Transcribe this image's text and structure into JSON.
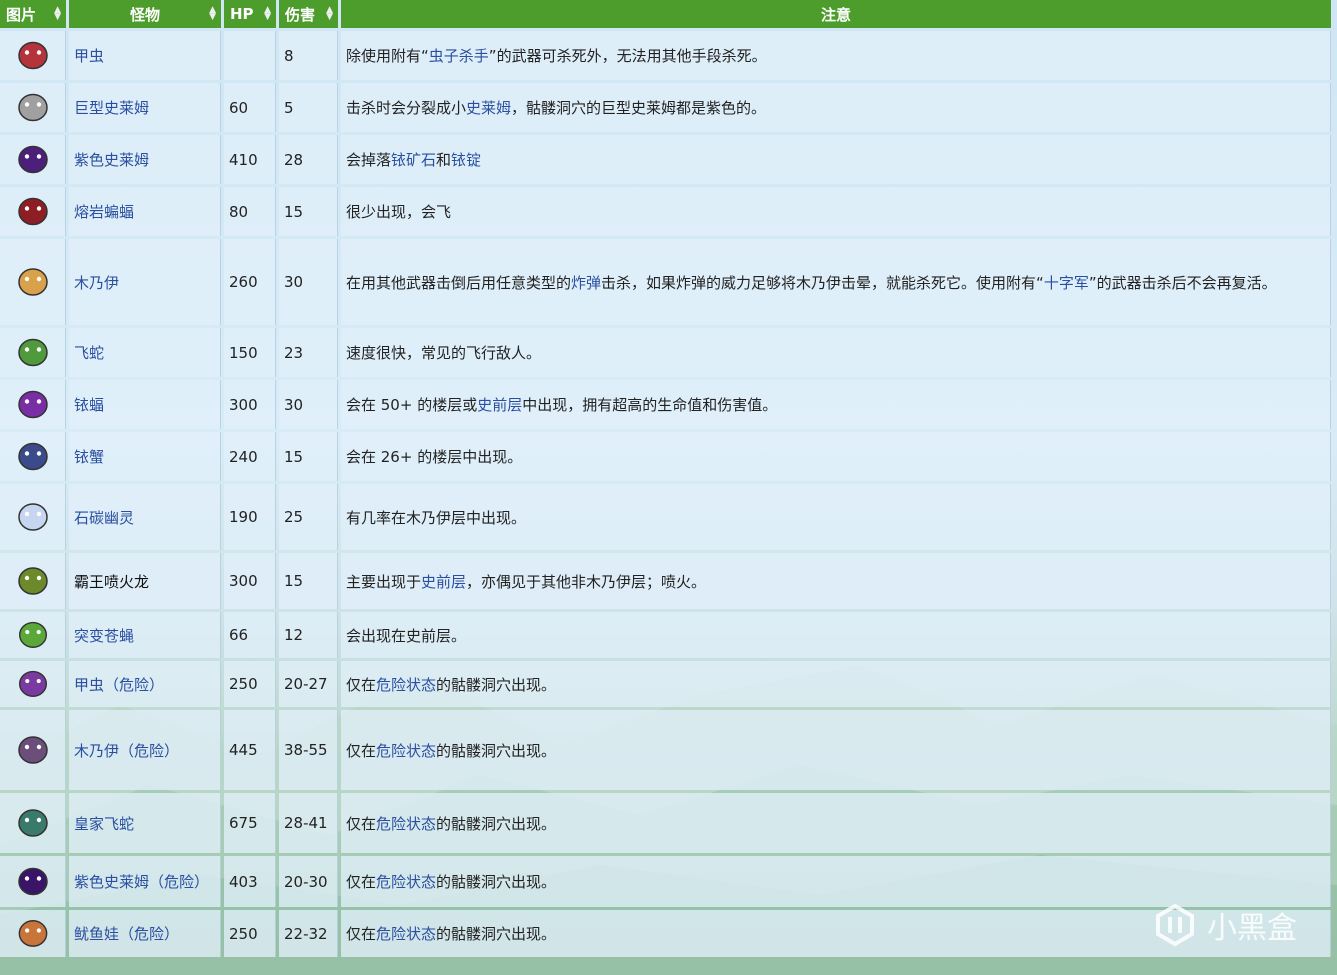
{
  "columns": [
    "图片",
    "怪物",
    "HP",
    "伤害",
    "注意"
  ],
  "rows": [
    {
      "name": "甲虫",
      "name_style": "lnk",
      "hp": "",
      "dmg": "8",
      "note": [
        {
          "t": "除使用附有“"
        },
        {
          "t": "虫子杀手",
          "l": true
        },
        {
          "t": "”的武器可杀死外，无法用其他手段杀死。"
        }
      ],
      "icon": "red-bug-icon",
      "color": "#b5333a"
    },
    {
      "name": "巨型史莱姆",
      "name_style": "lnk",
      "hp": "60",
      "dmg": "5",
      "note": [
        {
          "t": "击杀时会分裂成小"
        },
        {
          "t": "史莱姆",
          "l": true
        },
        {
          "t": "，骷髅洞穴的巨型史莱姆都是紫色的。"
        }
      ],
      "icon": "gray-slime-icon",
      "color": "#a0a0a0"
    },
    {
      "name": "紫色史莱姆",
      "name_style": "lnk",
      "hp": "410",
      "dmg": "28",
      "note": [
        {
          "t": "会掉落"
        },
        {
          "t": "铱矿石",
          "l": true
        },
        {
          "t": "和"
        },
        {
          "t": "铱锭",
          "l": true
        }
      ],
      "icon": "purple-slime-icon",
      "color": "#4b1f7a"
    },
    {
      "name": "熔岩蝙蝠",
      "name_style": "lnk",
      "hp": "80",
      "dmg": "15",
      "note": [
        {
          "t": "很少出现，会飞"
        }
      ],
      "icon": "lava-bat-icon",
      "color": "#8e1d24"
    },
    {
      "name": "木乃伊",
      "name_style": "lnk",
      "hp": "260",
      "dmg": "30",
      "note": [
        {
          "t": "在用其他武器击倒后用任意类型的"
        },
        {
          "t": "炸弹",
          "l": true
        },
        {
          "t": "击杀，如果炸弹的威力足够将木乃伊击晕，就能杀死它。使用附有“"
        },
        {
          "t": "十字军",
          "l": true
        },
        {
          "t": "”的武器击杀后不会再复活。"
        }
      ],
      "icon": "mummy-icon",
      "color": "#d9a24a"
    },
    {
      "name": "飞蛇",
      "name_style": "lnk",
      "hp": "150",
      "dmg": "23",
      "note": [
        {
          "t": "速度很快，常见的飞行敌人。"
        }
      ],
      "icon": "serpent-icon",
      "color": "#4f9a3c"
    },
    {
      "name": "铱蝠",
      "name_style": "lnk",
      "hp": "300",
      "dmg": "30",
      "note": [
        {
          "t": "会在 50+ 的楼层或"
        },
        {
          "t": "史前层",
          "l": true
        },
        {
          "t": "中出现，拥有超高的生命值和伤害值。"
        }
      ],
      "icon": "iridium-bat-icon",
      "color": "#7a2ea6"
    },
    {
      "name": "铱蟹",
      "name_style": "lnk",
      "hp": "240",
      "dmg": "15",
      "note": [
        {
          "t": "会在 26+ 的楼层中出现。"
        }
      ],
      "icon": "iridium-crab-icon",
      "color": "#3b4a8a"
    },
    {
      "name": "石碳幽灵",
      "name_style": "lnk",
      "hp": "190",
      "dmg": "25",
      "note": [
        {
          "t": "有几率在木乃伊层中出现。"
        }
      ],
      "icon": "ghost-icon",
      "color": "#c6d6f0"
    },
    {
      "name": "霸王喷火龙",
      "name_style": "dark",
      "hp": "300",
      "dmg": "15",
      "note": [
        {
          "t": "主要出现于"
        },
        {
          "t": "史前层",
          "l": true
        },
        {
          "t": "，亦偶见于其他非木乃伊层；喷火。"
        }
      ],
      "icon": "pepper-rex-icon",
      "color": "#6c8a2a"
    },
    {
      "name": "突变苍蝇",
      "name_style": "lnk",
      "hp": "66",
      "dmg": "12",
      "note": [
        {
          "t": "会出现在史前层。"
        }
      ],
      "icon": "mutant-fly-icon",
      "color": "#5aa83a"
    },
    {
      "name": "甲虫（危险）",
      "name_style": "lnk",
      "hp": "250",
      "dmg": "20-27",
      "note": [
        {
          "t": "仅在"
        },
        {
          "t": "危险状态",
          "l": true
        },
        {
          "t": "的骷髅洞穴出现。"
        }
      ],
      "icon": "purple-bug-icon",
      "color": "#7a3aa0"
    },
    {
      "name": "木乃伊（危险）",
      "name_style": "lnk",
      "hp": "445",
      "dmg": "38-55",
      "note": [
        {
          "t": "仅在"
        },
        {
          "t": "危险状态",
          "l": true
        },
        {
          "t": "的骷髅洞穴出现。"
        }
      ],
      "icon": "dangerous-mummy-icon",
      "color": "#6b4f7a"
    },
    {
      "name": "皇家飞蛇",
      "name_style": "lnk",
      "hp": "675",
      "dmg": "28-41",
      "note": [
        {
          "t": "仅在"
        },
        {
          "t": "危险状态",
          "l": true
        },
        {
          "t": "的骷髅洞穴出现。"
        }
      ],
      "icon": "royal-serpent-icon",
      "color": "#3a7a6a"
    },
    {
      "name": "紫色史莱姆（危险）",
      "name_style": "lnk",
      "hp": "403",
      "dmg": "20-30",
      "note": [
        {
          "t": "仅在"
        },
        {
          "t": "危险状态",
          "l": true
        },
        {
          "t": "的骷髅洞穴出现。"
        }
      ],
      "icon": "dark-purple-slime-icon",
      "color": "#3a1466"
    },
    {
      "name": "鱿鱼娃（危险）",
      "name_style": "lnk",
      "hp": "250",
      "dmg": "22-32",
      "note": [
        {
          "t": "仅在"
        },
        {
          "t": "危险状态",
          "l": true
        },
        {
          "t": "的骷髅洞穴出现。"
        }
      ],
      "icon": "squid-kid-icon",
      "color": "#c8743a"
    }
  ],
  "watermark": "小黑盒"
}
